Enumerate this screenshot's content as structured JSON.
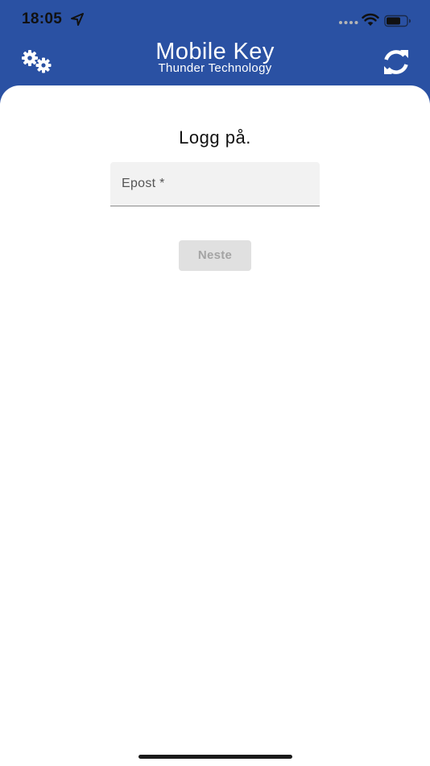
{
  "status_bar": {
    "time": "18:05",
    "icons": [
      "location-arrow-icon",
      "signal-icon",
      "wifi-icon",
      "battery-icon"
    ]
  },
  "header": {
    "title": "Mobile Key",
    "subtitle": "Thunder Technology",
    "left_icon": "settings-gears-icon",
    "right_icon": "refresh-icon"
  },
  "login": {
    "heading": "Logg på.",
    "email_label": "Epost *",
    "email_value": "",
    "next_label": "Neste"
  },
  "colors": {
    "brand_blue": "#2a51a3",
    "background": "#ffffff",
    "field_background": "#f2f2f2",
    "button_disabled_bg": "#e0e0e0",
    "button_disabled_text": "#a4a4a4"
  }
}
